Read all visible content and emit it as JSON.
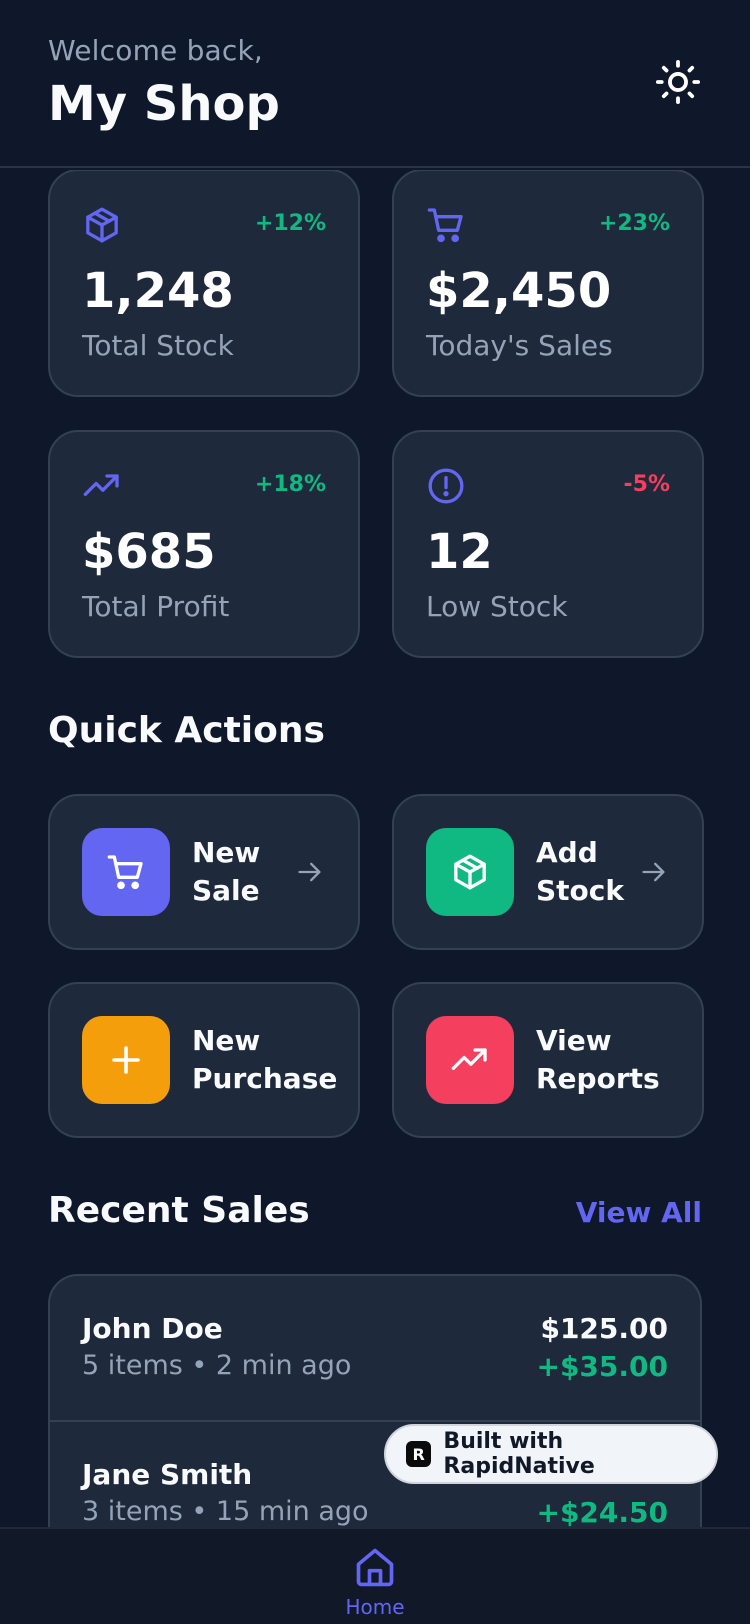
{
  "header": {
    "welcome": "Welcome back,",
    "title": "My Shop",
    "theme_icon": "sun-icon"
  },
  "stats": [
    {
      "icon": "package-icon",
      "change": "+12%",
      "value": "1,248",
      "label": "Total Stock",
      "trend": "positive"
    },
    {
      "icon": "cart-icon",
      "change": "+23%",
      "value": "$2,450",
      "label": "Today's Sales",
      "trend": "positive"
    },
    {
      "icon": "trending-up-icon",
      "change": "+18%",
      "value": "$685",
      "label": "Total Profit",
      "trend": "positive"
    },
    {
      "icon": "alert-circle-icon",
      "change": "-5%",
      "value": "12",
      "label": "Low Stock",
      "trend": "negative"
    }
  ],
  "quick_actions": {
    "title": "Quick Actions",
    "items": [
      {
        "label": "New Sale",
        "icon": "cart-icon",
        "color": "#6366f1"
      },
      {
        "label": "Add Stock",
        "icon": "package-icon",
        "color": "#10b981"
      },
      {
        "label": "New Purchase",
        "icon": "plus-icon",
        "color": "#f59e0b"
      },
      {
        "label": "View Reports",
        "icon": "trending-up-icon",
        "color": "#f43f5e"
      }
    ]
  },
  "recent_sales": {
    "title": "Recent Sales",
    "view_all": "View All",
    "items": [
      {
        "name": "John Doe",
        "meta": "5 items • 2 min ago",
        "amount": "$125.00",
        "profit": "+$35.00"
      },
      {
        "name": "Jane Smith",
        "meta": "3 items • 15 min ago",
        "amount": "",
        "profit": "+$24.50"
      }
    ]
  },
  "badge": {
    "logo": "R",
    "text": "Built with RapidNative"
  },
  "tabbar": {
    "home_label": "Home",
    "home_icon": "home-icon"
  },
  "colors": {
    "background": "#0f172a",
    "card": "#1e293b",
    "accent": "#6366f1",
    "positive": "#10b981",
    "negative": "#f43f5e"
  }
}
